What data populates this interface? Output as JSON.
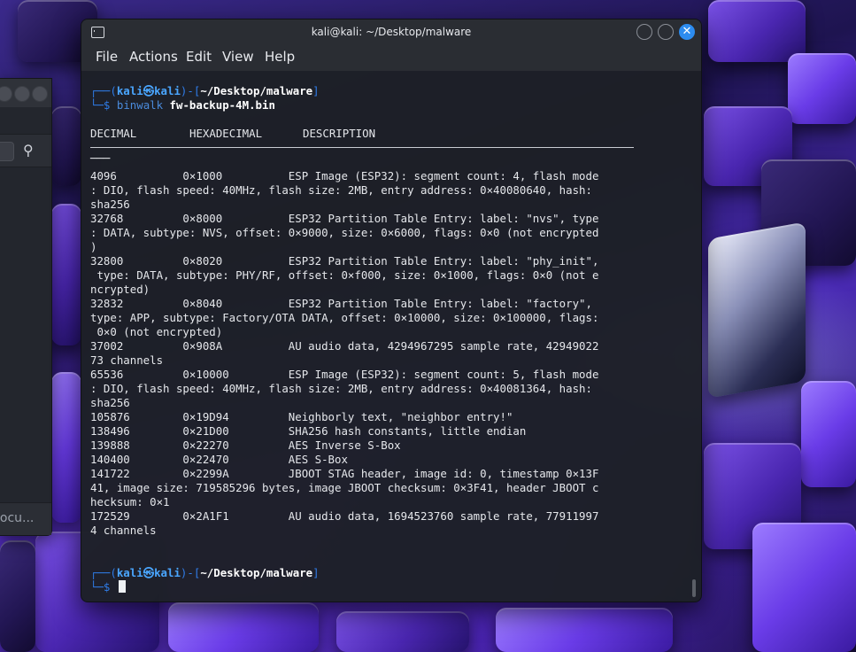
{
  "background_window": {
    "footer_text": "locu...",
    "search_icon": "search-icon"
  },
  "terminal": {
    "title": "kali@kali: ~/Desktop/malware",
    "close_glyph": "✕",
    "menu": [
      "File",
      "Actions",
      "Edit",
      "View",
      "Help"
    ],
    "prompt1": {
      "open": "┌──(",
      "user": "kali",
      "at": "㉿",
      "host": "kali",
      "mid": ")-[",
      "path": "~/Desktop/malware",
      "close": "]",
      "prefix": "└─",
      "dollar": "$",
      "command": "binwalk",
      "argument": "fw-backup-4M.bin"
    },
    "header": {
      "decimal": "DECIMAL",
      "hex": "HEXADECIMAL",
      "desc": "DESCRIPTION"
    },
    "separator_tail": "───",
    "output_lines": [
      "4096          0×1000          ESP Image (ESP32): segment count: 4, flash mode",
      ": DIO, flash speed: 40MHz, flash size: 2MB, entry address: 0×40080640, hash:",
      "sha256",
      "32768         0×8000          ESP32 Partition Table Entry: label: \"nvs\", type",
      ": DATA, subtype: NVS, offset: 0×9000, size: 0×6000, flags: 0×0 (not encrypted",
      ")",
      "32800         0×8020          ESP32 Partition Table Entry: label: \"phy_init\",",
      " type: DATA, subtype: PHY/RF, offset: 0×f000, size: 0×1000, flags: 0×0 (not e",
      "ncrypted)",
      "32832         0×8040          ESP32 Partition Table Entry: label: \"factory\",",
      "type: APP, subtype: Factory/OTA DATA, offset: 0×10000, size: 0×100000, flags:",
      " 0×0 (not encrypted)",
      "37002         0×908A          AU audio data, 4294967295 sample rate, 42949022",
      "73 channels",
      "65536         0×10000         ESP Image (ESP32): segment count: 5, flash mode",
      ": DIO, flash speed: 40MHz, flash size: 2MB, entry address: 0×40081364, hash:",
      "sha256",
      "105876        0×19D94         Neighborly text, \"neighbor entry!\"",
      "138496        0×21D00         SHA256 hash constants, little endian",
      "139888        0×22270         AES Inverse S-Box",
      "140400        0×22470         AES S-Box",
      "141722        0×2299A         JBOOT STAG header, image id: 0, timestamp 0×13F",
      "41, image size: 719585296 bytes, image JBOOT checksum: 0×3F41, header JBOOT c",
      "hecksum: 0×1",
      "172529        0×2A1F1         AU audio data, 1694523760 sample rate, 77911997",
      "4 channels"
    ],
    "prompt2": {
      "open": "┌──(",
      "user": "kali",
      "at": "㉿",
      "host": "kali",
      "mid": ")-[",
      "path": "~/Desktop/malware",
      "close": "]",
      "prefix": "└─",
      "dollar": "$"
    }
  }
}
